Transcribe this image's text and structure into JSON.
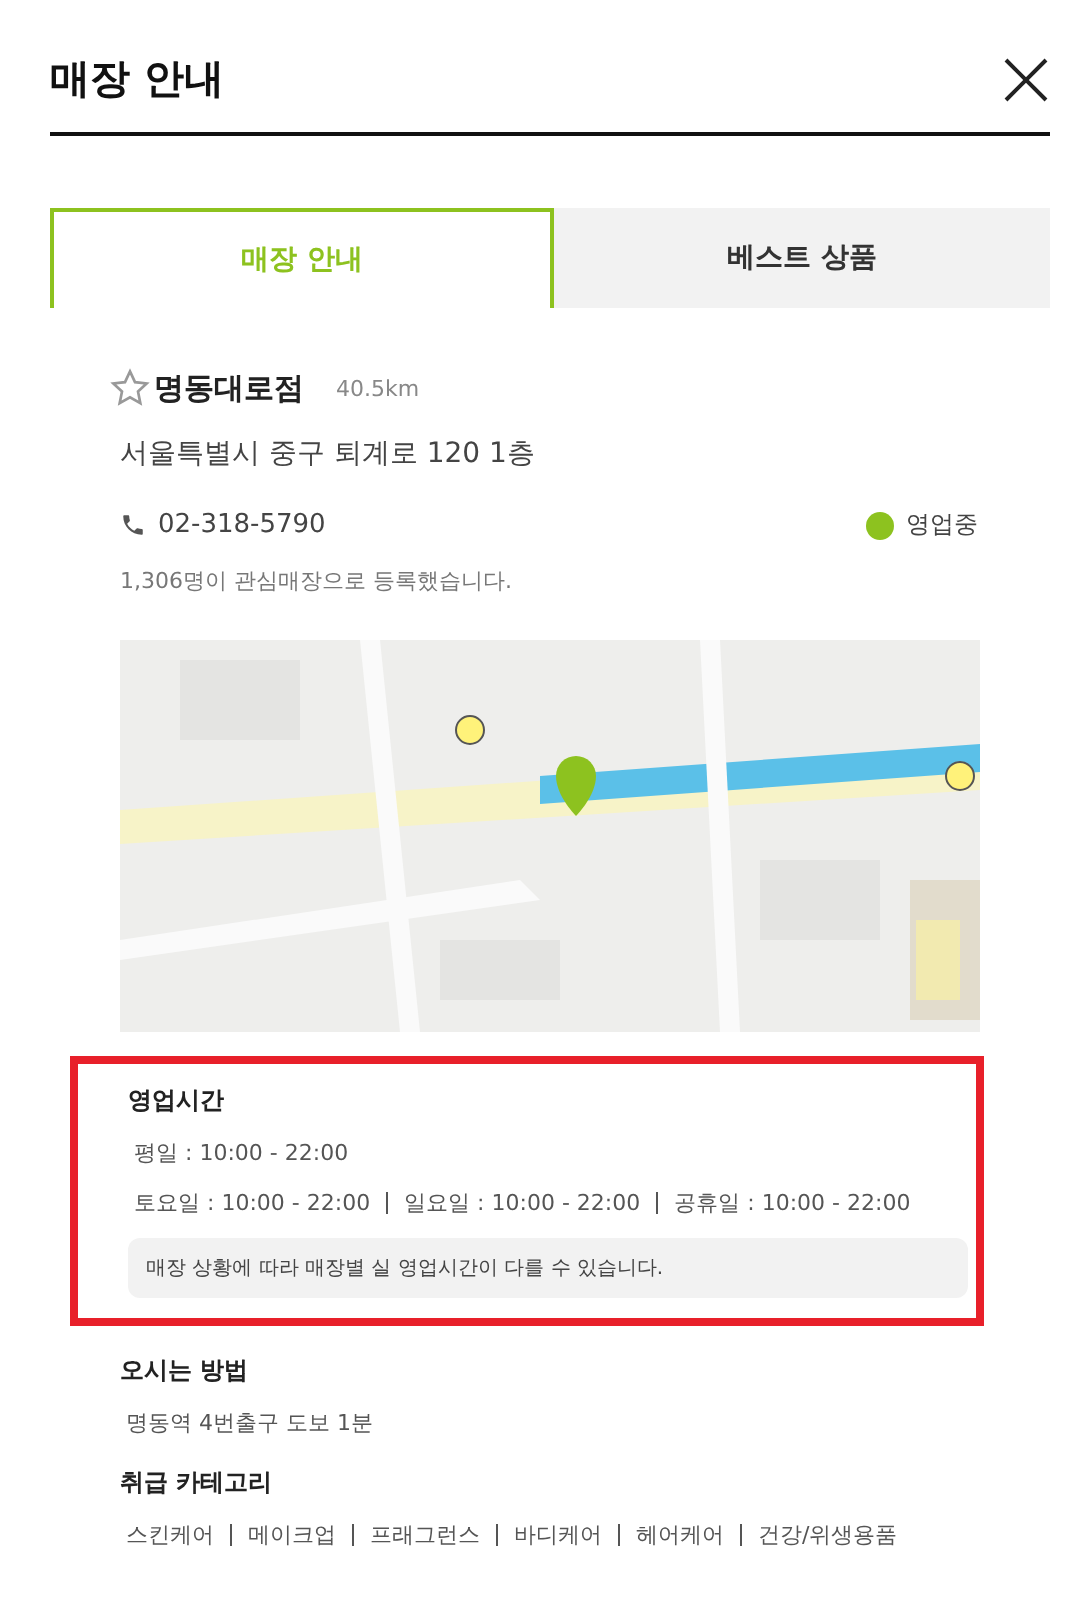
{
  "header": {
    "title": "매장 안내"
  },
  "tabs": [
    {
      "label": "매장 안내",
      "selected": true
    },
    {
      "label": "베스트 상품",
      "selected": false
    }
  ],
  "store": {
    "name": "명동대로점",
    "favorite": false,
    "distance": "40.5km",
    "address": "서울특별시 중구 퇴계로 120 1층",
    "phone": "02-318-5790",
    "status": {
      "label": "영업중",
      "color": "#8dc21f"
    },
    "note": "1,306명이 관심매장으로 등록했습니다."
  },
  "hours": {
    "highlighted": true,
    "title": "영업시간",
    "weekday": "평일 : 10:00 - 22:00",
    "others": [
      "토요일 : 10:00 - 22:00",
      "일요일 : 10:00 - 22:00",
      "공휴일 : 10:00 - 22:00"
    ],
    "notice": "매장 상황에 따라 매장별 실 영업시간이 다를 수 있습니다."
  },
  "directions": {
    "title": "오시는 방법",
    "text": "명동역 4번출구 도보 1분"
  },
  "categories": {
    "title": "취급 카테고리",
    "items": [
      "스킨케어",
      "메이크업",
      "프래그런스",
      "바디케어",
      "헤어케어",
      "건강/위생용품"
    ]
  }
}
